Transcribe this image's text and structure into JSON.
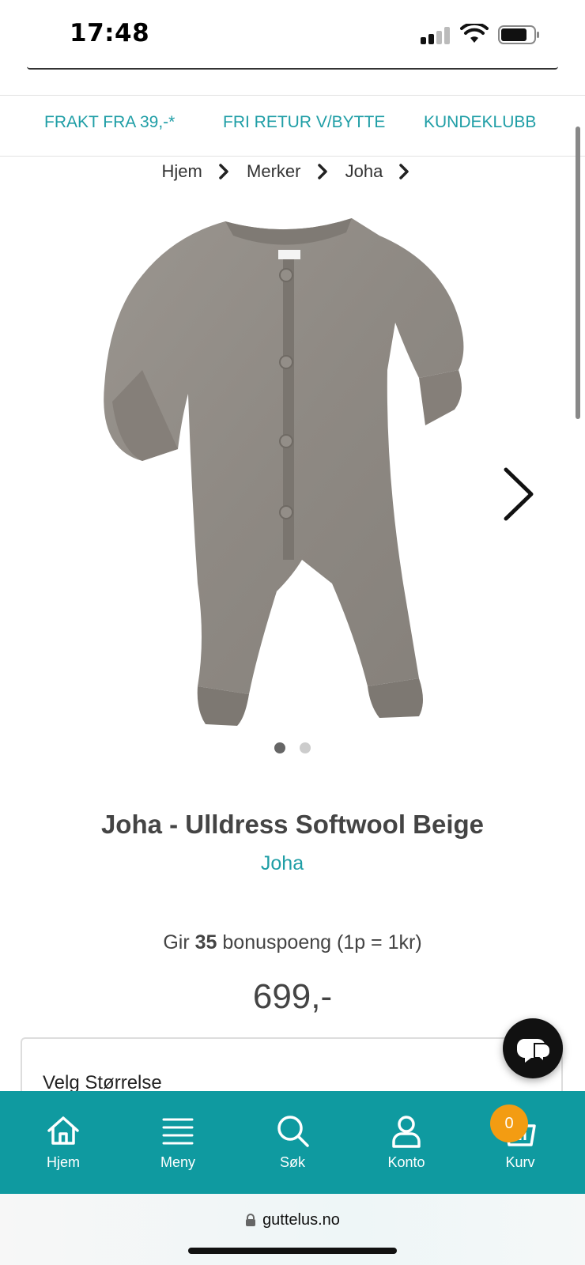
{
  "status_bar": {
    "time": "17:48"
  },
  "promo": {
    "items": [
      "FRAKT FRA 39,-*",
      "FRI RETUR V/BYTTE",
      "KUNDEKLUBB"
    ],
    "color": "#1f9ea6"
  },
  "breadcrumb": [
    "Hjem",
    "Merker",
    "Joha"
  ],
  "product": {
    "image_icon": "wool-jumpsuit-image",
    "image_count": 2,
    "active_image": 1,
    "title": "Joha - Ulldress Softwool Beige",
    "brand": "Joha",
    "bonus_prefix": "Gir",
    "bonus_points": "35",
    "bonus_suffix": "bonuspoeng (1p = 1kr)",
    "price": "699,-"
  },
  "size_select": {
    "label": "Velg Størrelse"
  },
  "bottom_nav": {
    "items": [
      {
        "label": "Hjem",
        "icon": "home-icon"
      },
      {
        "label": "Meny",
        "icon": "menu-icon"
      },
      {
        "label": "Søk",
        "icon": "search-icon"
      },
      {
        "label": "Konto",
        "icon": "account-icon"
      },
      {
        "label": "Kurv",
        "icon": "basket-icon"
      }
    ],
    "cart_count": "0",
    "background": "#0f9aa0",
    "badge_color": "#f39c12"
  },
  "browser": {
    "url": "guttelus.no"
  }
}
